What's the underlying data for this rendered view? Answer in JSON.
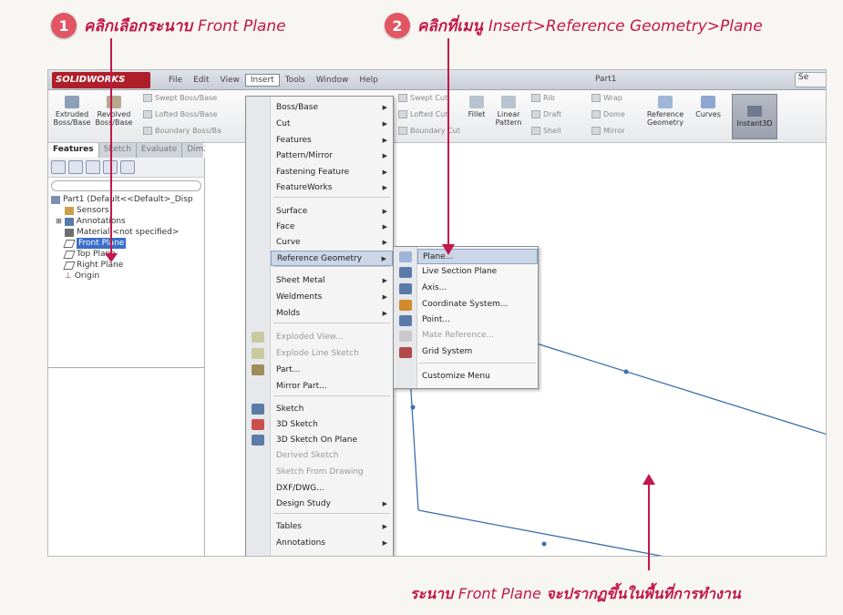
{
  "annotations": {
    "step1": {
      "num": "1",
      "prefix": "คลิกเลือกระนาบ",
      "em": "Front Plane"
    },
    "step2": {
      "num": "2",
      "prefix": "คลิกที่เมนู",
      "em": "Insert>Reference  Geometry>Plane"
    },
    "caption": {
      "prefix": "ระนาบ",
      "em": "Front Plane",
      "suffix": "จะปรากฏขึ้นในพื้นที่การทำงาน"
    }
  },
  "app": {
    "logo": "SOLIDWORKS",
    "menus": [
      "File",
      "Edit",
      "View",
      "Insert",
      "Tools",
      "Window",
      "Help"
    ],
    "doc_title": "Part1",
    "search": "Se"
  },
  "ribbon": {
    "extruded": "Extruded Boss/Base",
    "revolved": "Revolved Boss/Base",
    "swept": "Swept Boss/Base",
    "lofted": "Lofted Boss/Base",
    "boundary": "Boundary Boss/Ba",
    "swept_cut": "Swept Cut",
    "lofted_cut": "Lofted Cut",
    "boundary_cut": "Boundary Cut",
    "fillet": "Fillet",
    "linear_pattern": "Linear Pattern",
    "rib": "Rib",
    "draft": "Draft",
    "shell": "Shell",
    "wrap": "Wrap",
    "dome": "Dome",
    "mirror": "Mirror",
    "ref_geometry": "Reference Geometry",
    "curves": "Curves",
    "instant3d": "Instant3D"
  },
  "tabs": [
    "Features",
    "Sketch",
    "Evaluate",
    "DimXpert"
  ],
  "tree": {
    "filter": "",
    "part": "Part1  (Default<<Default>_Disp",
    "items": [
      "Sensors",
      "Annotations",
      "Material <not specified>",
      "Front Plane",
      "Top Plane",
      "Right Plane",
      "Origin"
    ]
  },
  "insert_menu": [
    {
      "label": "Boss/Base",
      "sub": true
    },
    {
      "label": "Cut",
      "sub": true
    },
    {
      "label": "Features",
      "sub": true
    },
    {
      "label": "Pattern/Mirror",
      "sub": true
    },
    {
      "label": "Fastening Feature",
      "sub": true
    },
    {
      "label": "FeatureWorks",
      "sub": true
    },
    {
      "label": "Surface",
      "sub": true
    },
    {
      "label": "Face",
      "sub": true
    },
    {
      "label": "Curve",
      "sub": true
    },
    {
      "label": "Reference Geometry",
      "sub": true
    },
    {
      "label": "Sheet Metal",
      "sub": true
    },
    {
      "label": "Weldments",
      "sub": true
    },
    {
      "label": "Molds",
      "sub": true
    },
    {
      "label": "Exploded View...",
      "sub": false
    },
    {
      "label": "Explode Line Sketch",
      "sub": false
    },
    {
      "label": "Part...",
      "sub": false
    },
    {
      "label": "Mirror Part...",
      "sub": false
    },
    {
      "label": "Sketch",
      "sub": false
    },
    {
      "label": "3D Sketch",
      "sub": false
    },
    {
      "label": "3D Sketch On Plane",
      "sub": false
    },
    {
      "label": "Derived Sketch",
      "sub": false
    },
    {
      "label": "Sketch From Drawing",
      "sub": false
    },
    {
      "label": "DXF/DWG...",
      "sub": false
    },
    {
      "label": "Design Study",
      "sub": true
    },
    {
      "label": "Tables",
      "sub": true
    },
    {
      "label": "Annotations",
      "sub": true
    }
  ],
  "ref_geometry_menu": [
    "Plane...",
    "Live Section Plane",
    "Axis...",
    "Coordinate System...",
    "Point...",
    "Mate Reference...",
    "Grid System",
    "Customize Menu"
  ],
  "colors": {
    "annotation": "#c2184b",
    "badge": "#e25562",
    "logo": "#ae1f2a",
    "plane_edge": "#3a6fb0",
    "highlight": "#cbd6e6"
  }
}
